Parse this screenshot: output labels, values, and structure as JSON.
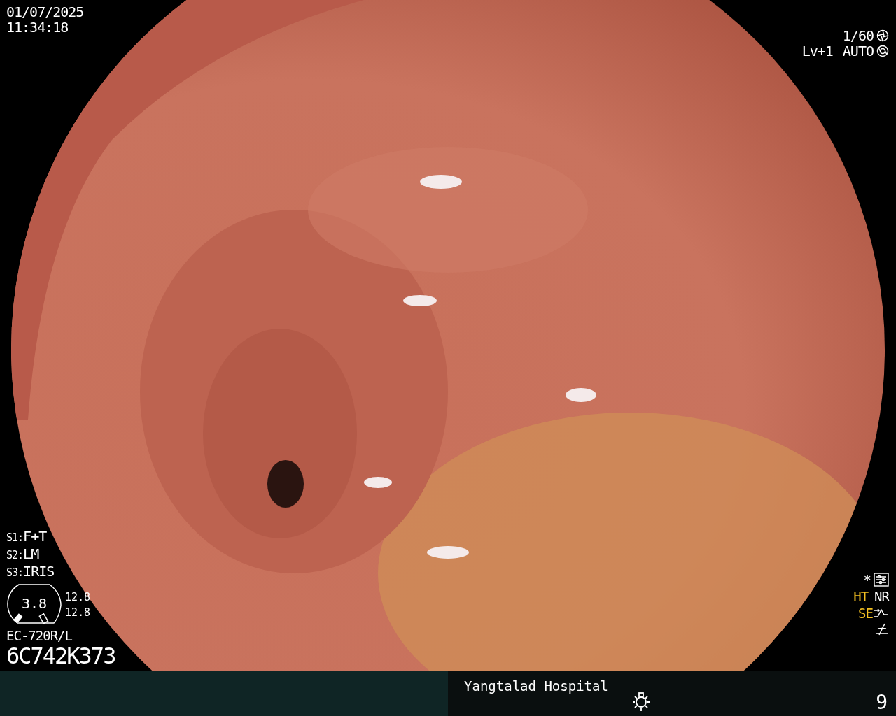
{
  "timestamp": {
    "date": "01/07/2025",
    "time": "11:34:18"
  },
  "exposure": {
    "shutter": "1/60",
    "level": "Lv+1",
    "iris_mode": "AUTO"
  },
  "switches": [
    {
      "key": "S1:",
      "value": "F+T"
    },
    {
      "key": "S2:",
      "value": "LM"
    },
    {
      "key": "S3:",
      "value": "IRIS"
    }
  ],
  "gauge": {
    "value": "3.8",
    "readings": [
      "12.8",
      "12.8"
    ]
  },
  "scope": {
    "model": "EC-720R/L",
    "serial": "6C742K373"
  },
  "enhancement": {
    "mark": "*",
    "indicators": [
      {
        "label": "HT",
        "on": true
      },
      {
        "label": "NR",
        "on": false
      }
    ],
    "edge": {
      "label": "SE",
      "on": true
    }
  },
  "status_bar": {
    "hospital": "Yangtalad Hospital",
    "page": "9"
  }
}
